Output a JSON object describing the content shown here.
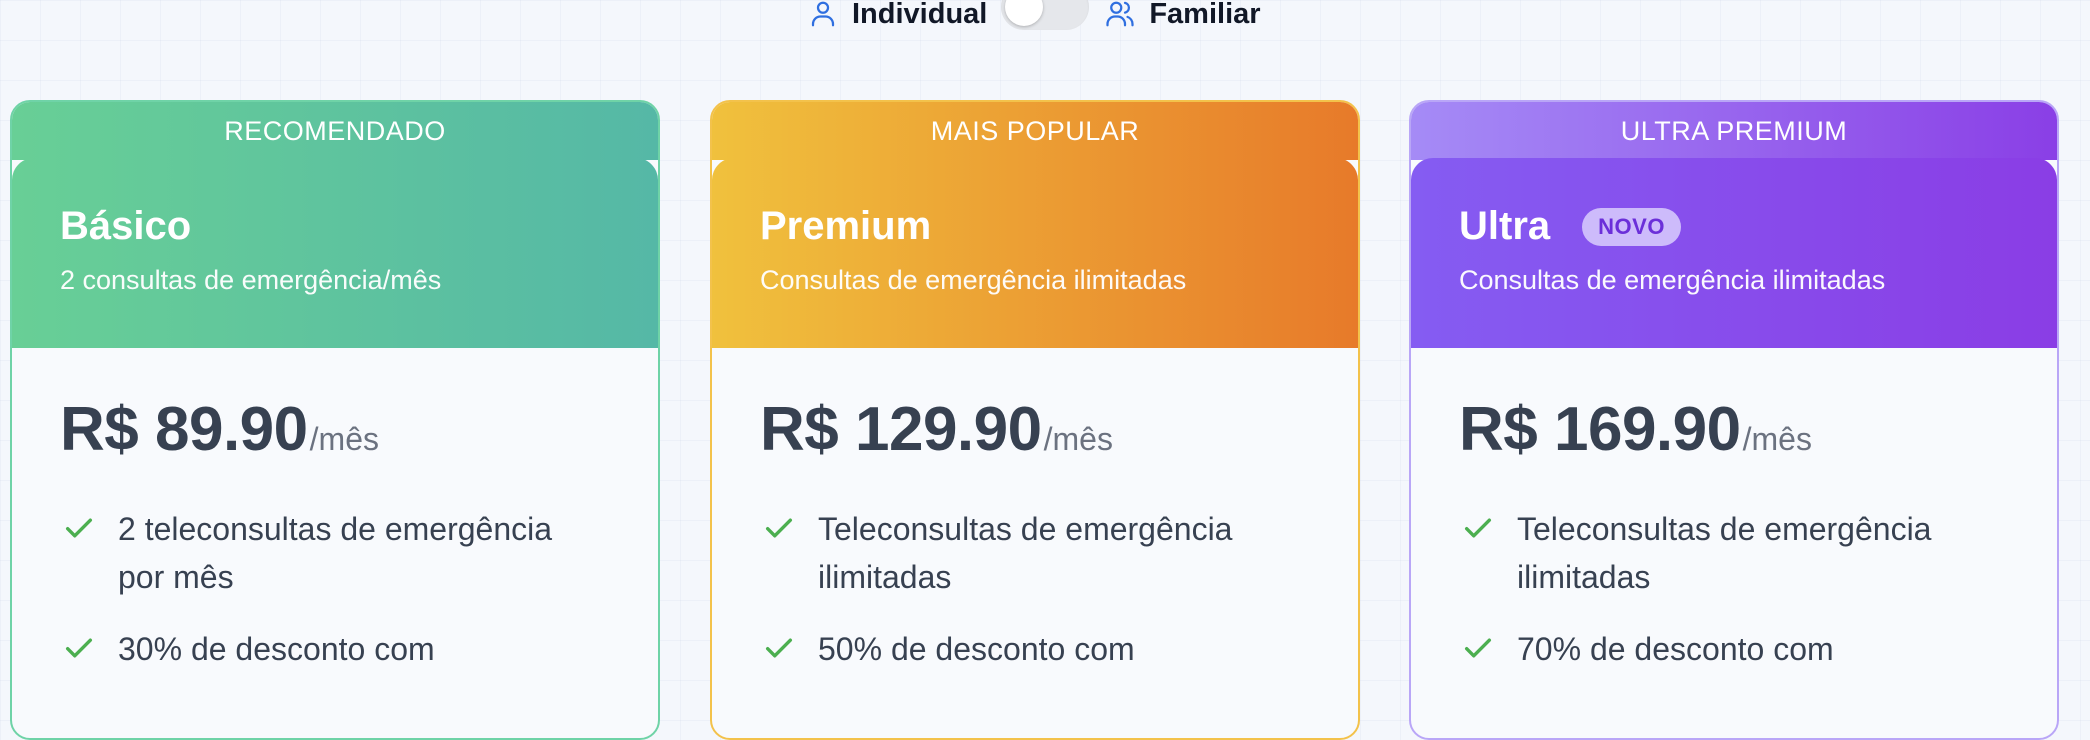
{
  "toggle": {
    "individual_label": "Individual",
    "familiar_label": "Familiar",
    "individual_icon": "user-icon",
    "familiar_icon": "users-icon",
    "state": "individual"
  },
  "plans": [
    {
      "ribbon": "RECOMENDADO",
      "name": "Básico",
      "badge": "",
      "description": "2 consultas de emergência/mês",
      "price": "R$ 89.90",
      "period": "/mês",
      "features": [
        "2 teleconsultas de emergência por mês",
        "30% de desconto com"
      ],
      "colors": {
        "start": "#68cf96",
        "end": "#55b8a6",
        "border": "#6fd3a7"
      }
    },
    {
      "ribbon": "MAIS POPULAR",
      "name": "Premium",
      "badge": "",
      "description": "Consultas de emergência ilimitadas",
      "price": "R$ 129.90",
      "period": "/mês",
      "features": [
        "Teleconsultas de emergência ilimitadas",
        "50% de desconto com"
      ],
      "colors": {
        "start": "#f0c13d",
        "end": "#e77a2a",
        "border": "#f3c24b"
      }
    },
    {
      "ribbon": "ULTRA PREMIUM",
      "name": "Ultra",
      "badge": "NOVO",
      "description": "Consultas de emergência ilimitadas",
      "price": "R$ 169.90",
      "period": "/mês",
      "features": [
        "Teleconsultas de emergência ilimitadas",
        "70% de desconto com"
      ],
      "colors": {
        "start": "#855cf2",
        "end": "#8a3de5",
        "border": "#b9a6f7"
      }
    }
  ],
  "check_color": "#4caf50"
}
